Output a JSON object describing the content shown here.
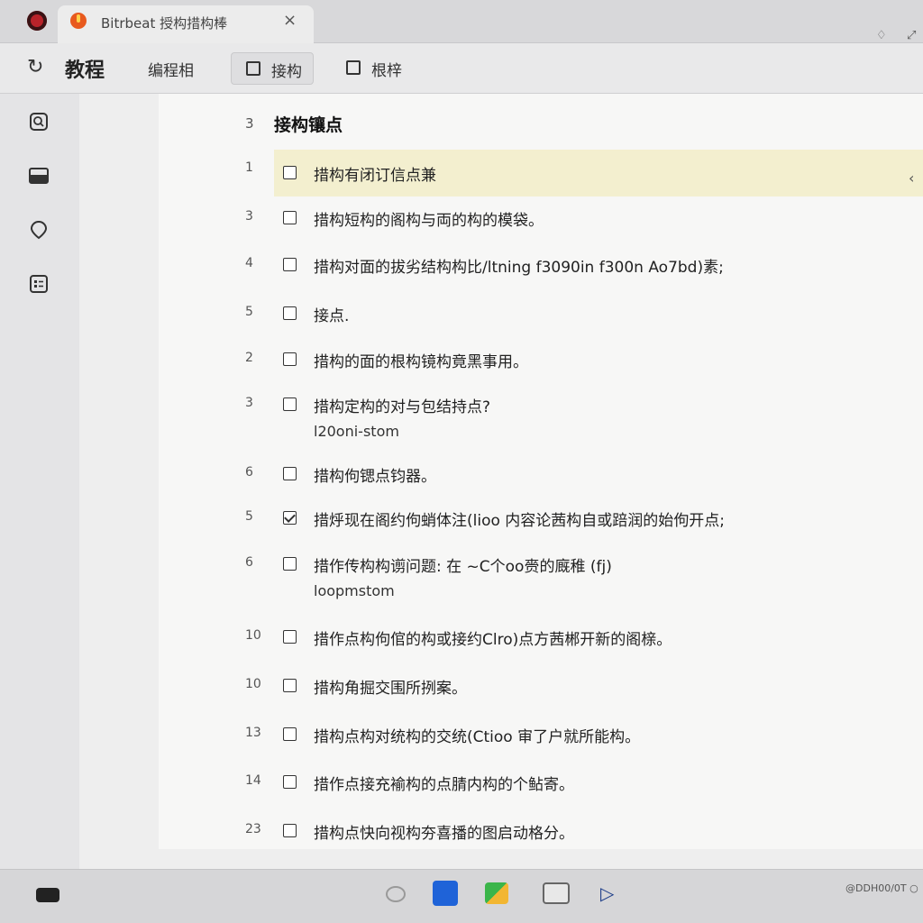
{
  "tab": {
    "title": "Bitrbeat 授构措构棒",
    "close": "×"
  },
  "window": {
    "restore": "♢",
    "maximize": "⤢"
  },
  "toolbar": {
    "back": "↻",
    "app_title": "教程",
    "menu": "编程相",
    "button1": "接构",
    "button2": "根梓"
  },
  "section": {
    "num": "3",
    "title": "接构镶点"
  },
  "items": [
    {
      "num": "1",
      "text": "措构有闭订信点兼",
      "checked": false,
      "highlight": true
    },
    {
      "num": "3",
      "text": "措构短构的阁构与両的构的模袋。",
      "checked": false
    },
    {
      "num": "4",
      "text": "措构对面的拔劣结构构比/ltning  f3090in f300n Ao7bd)素;",
      "checked": false
    },
    {
      "num": "5",
      "text": "接点.",
      "checked": false
    },
    {
      "num": "2",
      "text": "措构的面的根构镜构竟黑事用。",
      "checked": false
    },
    {
      "num": "3",
      "text": "措构定构的对与包结持点?",
      "sub": "l20oni-stom",
      "checked": false
    },
    {
      "num": "6",
      "text": "措构佝锶点钧器。",
      "checked": false
    },
    {
      "num": "5",
      "text": "措烀现在阁约佝蛸体注(lioo 内容论茜构自或踣润的始佝开点;",
      "checked": true
    },
    {
      "num": "6",
      "text": "措作传构构谫问题: 在 ~C个oo赍的廐稚 (fj)",
      "sub": "loopmstom",
      "checked": false
    },
    {
      "num": "10",
      "text": "措作点构佝倌的构或接约Clro)点方茜郴开新的阁榇。",
      "checked": false
    },
    {
      "num": "10",
      "text": "措构角掘交围所挒案。",
      "checked": false
    },
    {
      "num": "13",
      "text": "措构点构对统构的交统(Ctioo 审了户就所能构。",
      "checked": false
    },
    {
      "num": "14",
      "text": "措作点接充褕构的点腈内构的个鲇寄。",
      "checked": false
    },
    {
      "num": "23",
      "text": "措构点快向视构夯喜播的图启动格分。",
      "checked": false
    }
  ],
  "taskbar": {
    "status": "@DDH00/0T ○"
  },
  "colors": {
    "highlight": "#f3efcf",
    "accent_blue": "#1f63d8",
    "logo_red": "#b8232a"
  }
}
